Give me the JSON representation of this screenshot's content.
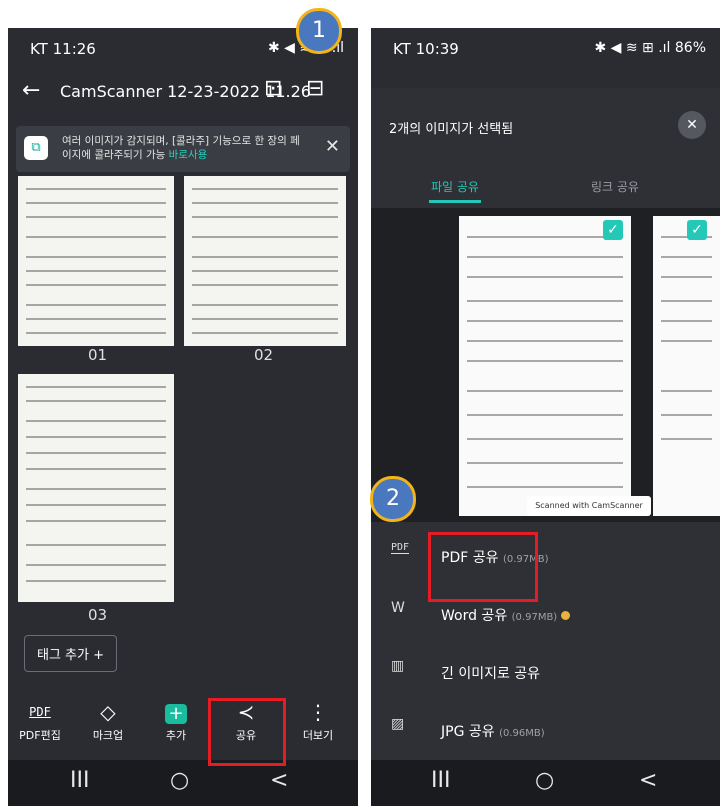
{
  "left": {
    "status": {
      "time": "KT 11:26",
      "icons": "✱ ◀ ≋ ⊞ .ıl"
    },
    "appbar": {
      "back": "←",
      "title": "CamScanner 12-23-2022 11.26"
    },
    "banner": {
      "text": "여러 이미지가 감지되며, [콜라주] 기능으로 한 장의 페이지에 콜라주되기 가능",
      "link": "바로사용",
      "close": "✕"
    },
    "pages": [
      "01",
      "02",
      "03"
    ],
    "tag_button": "태그 추가 +",
    "toolbar": [
      {
        "label": "PDF편집",
        "icon": "PDF"
      },
      {
        "label": "마크업",
        "icon": "◇"
      },
      {
        "label": "추가",
        "icon": "+"
      },
      {
        "label": "공유",
        "icon": "≺"
      },
      {
        "label": "더보기",
        "icon": "⋮"
      }
    ],
    "nav": [
      "III",
      "○",
      "<"
    ]
  },
  "right": {
    "status": {
      "time": "KT 10:39",
      "icons": "✱ ◀ ≋ ⊞ .ıl 86%"
    },
    "sheet_title": "2개의 이미지가 선택됨",
    "close": "✕",
    "tabs": [
      "파일 공유",
      "링크 공유"
    ],
    "watermark": "Scanned with CamScanner",
    "menu": [
      {
        "icon": "PDF",
        "label": "PDF 공유",
        "size": "(0.97MB)"
      },
      {
        "icon": "W",
        "label": "Word 공유",
        "size": "(0.97MB)"
      },
      {
        "icon": "▥",
        "label": "긴 이미지로 공유",
        "size": ""
      },
      {
        "icon": "▨",
        "label": "JPG 공유",
        "size": "(0.96MB)"
      }
    ],
    "nav": [
      "III",
      "○",
      "<"
    ]
  },
  "badges": [
    "1",
    "2"
  ],
  "colors": {
    "accent": "#23c8b6",
    "highlight": "#e51c23",
    "badge": "#4a78be"
  }
}
